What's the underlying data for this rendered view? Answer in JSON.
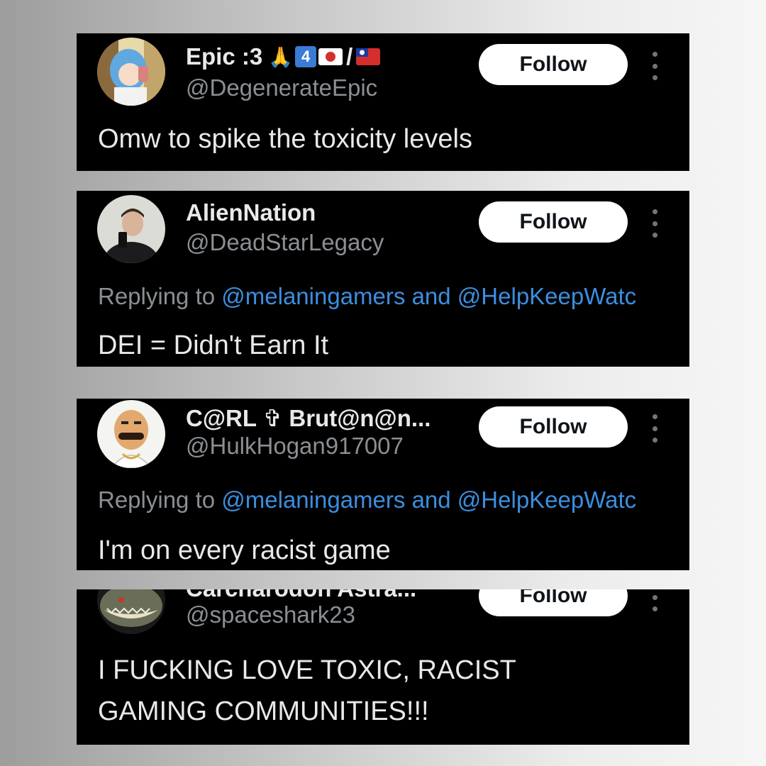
{
  "posts": [
    {
      "name": "Epic :3",
      "name_badges": {
        "hands": "🙏",
        "keycap": "4",
        "slash": "/"
      },
      "handle": "@DegenerateEpic",
      "follow_label": "Follow",
      "text": "Omw to spike the toxicity levels"
    },
    {
      "name": "AlienNation",
      "handle": "@DeadStarLegacy",
      "follow_label": "Follow",
      "reply_prefix": "Replying to",
      "reply_mention_1": "@melaningamers",
      "reply_and": "and",
      "reply_mention_2": "@HelpKeepWatc",
      "text": "DEI = Didn't Earn It"
    },
    {
      "name": "C@RL ✞ Brut@n@n...",
      "handle": "@HulkHogan917007",
      "follow_label": "Follow",
      "reply_prefix": "Replying to",
      "reply_mention_1": "@melaningamers",
      "reply_and": "and",
      "reply_mention_2": "@HelpKeepWatc",
      "text": "I'm on every racist game"
    },
    {
      "name": "Carcharodon Astra...",
      "handle": "@spaceshark23",
      "follow_label": "Follow",
      "text_line_1": "I FUCKING LOVE TOXIC, RACIST",
      "text_line_2": "GAMING COMMUNITIES!!!"
    }
  ],
  "colors": {
    "card_bg": "#000000",
    "name": "#e7e9ea",
    "handle": "#8b8f93",
    "mention": "#3b8fe0",
    "follow_bg": "#ffffff"
  },
  "icons": [
    "more-vertical-icon",
    "praying-hands-emoji",
    "keycap-4-emoji",
    "japan-flag-emoji",
    "taiwan-flag-emoji"
  ]
}
